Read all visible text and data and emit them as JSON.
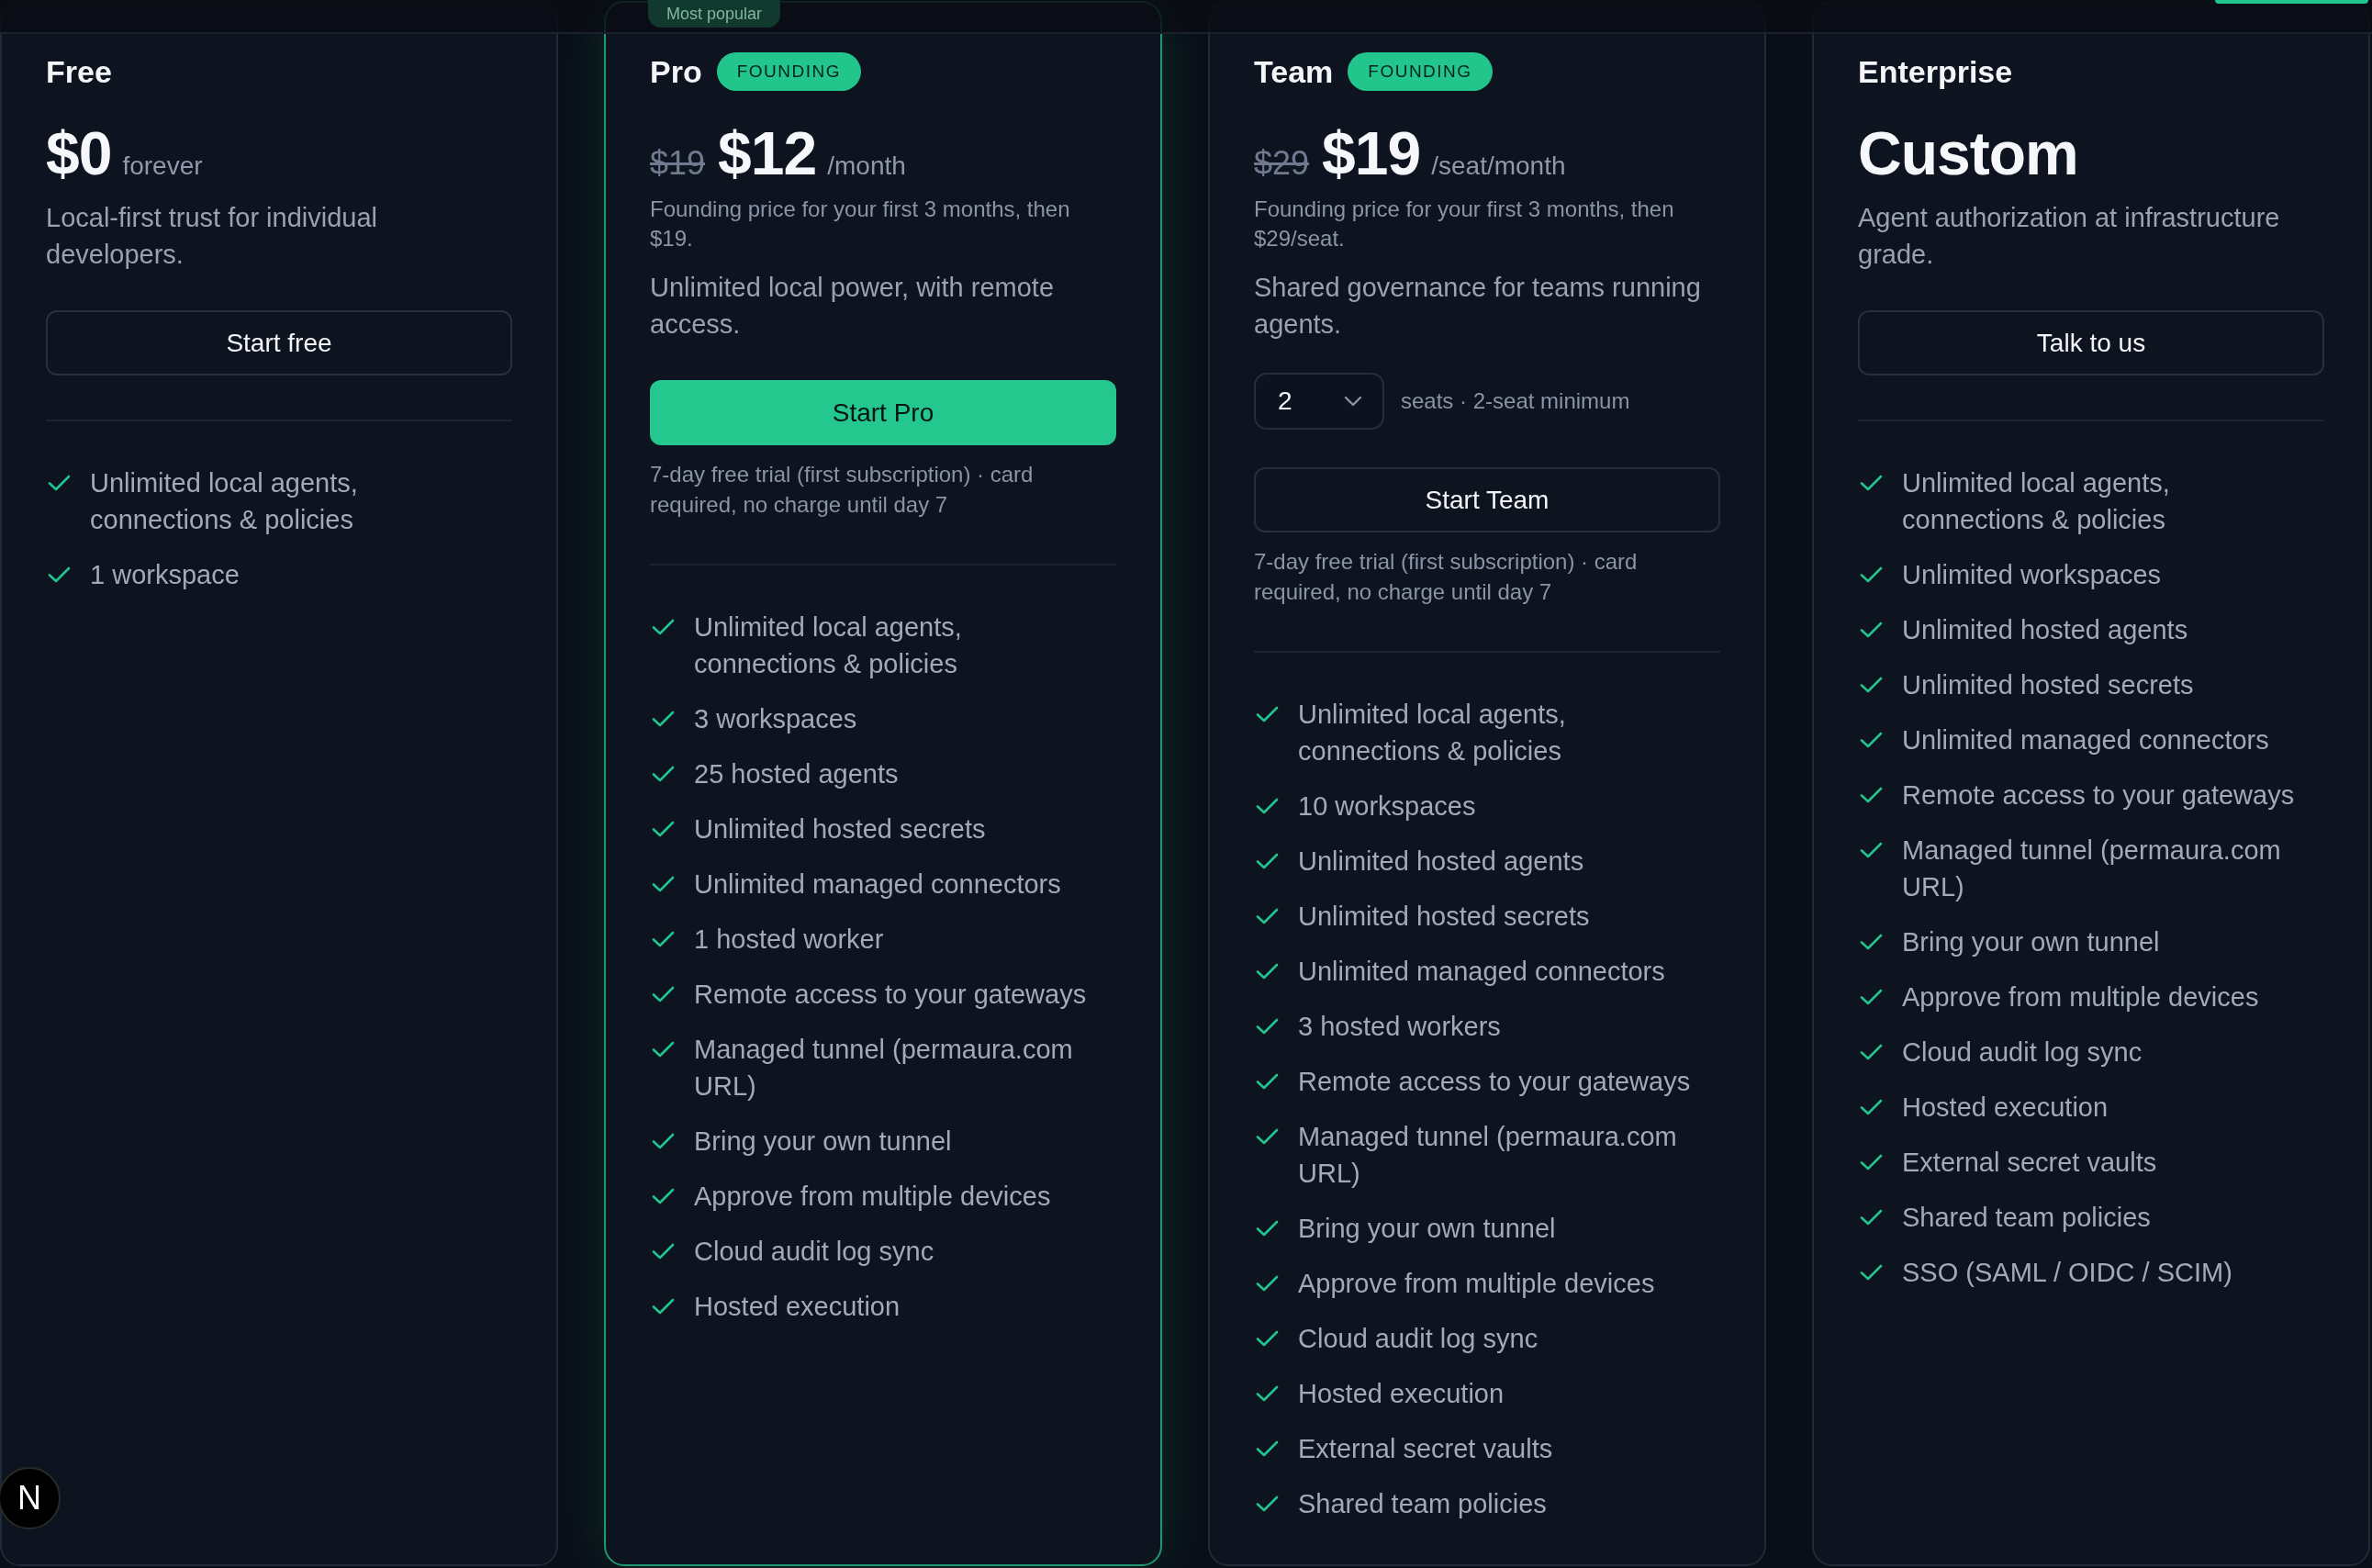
{
  "plans": [
    {
      "name": "Free",
      "featured": false,
      "price": "$0",
      "period": "forever",
      "description": "Local-first trust for individual developers.",
      "button": {
        "label": "Start free",
        "kind": "outline"
      },
      "features": [
        "Unlimited local agents, connections & policies",
        "1 workspace"
      ]
    },
    {
      "name": "Pro",
      "ribbon": "Most popular",
      "badge": "FOUNDING",
      "featured": true,
      "old_price": "$19",
      "price": "$12",
      "period": "/month",
      "note": "Founding price for your first 3 months, then $19.",
      "description": "Unlimited local power, with remote access.",
      "button": {
        "label": "Start Pro",
        "kind": "primary"
      },
      "trial_note": "7-day free trial (first subscription) · card required, no charge until day 7",
      "features": [
        "Unlimited local agents, connections & policies",
        "3 workspaces",
        "25 hosted agents",
        "Unlimited hosted secrets",
        "Unlimited managed connectors",
        "1 hosted worker",
        "Remote access to your gateways",
        "Managed tunnel (permaura.com URL)",
        "Bring your own tunnel",
        "Approve from multiple devices",
        "Cloud audit log sync",
        "Hosted execution"
      ]
    },
    {
      "name": "Team",
      "badge": "FOUNDING",
      "featured": false,
      "old_price": "$29",
      "price": "$19",
      "period": "/seat/month",
      "note": "Founding price for your first 3 months, then $29/seat.",
      "description": "Shared governance for teams running agents.",
      "seats": {
        "value": "2",
        "hint": "seats · 2-seat minimum"
      },
      "button": {
        "label": "Start Team",
        "kind": "outline"
      },
      "trial_note": "7-day free trial (first subscription) · card required, no charge until day 7",
      "features": [
        "Unlimited local agents, connections & policies",
        "10 workspaces",
        "Unlimited hosted agents",
        "Unlimited hosted secrets",
        "Unlimited managed connectors",
        "3 hosted workers",
        "Remote access to your gateways",
        "Managed tunnel (permaura.com URL)",
        "Bring your own tunnel",
        "Approve from multiple devices",
        "Cloud audit log sync",
        "Hosted execution",
        "External secret vaults",
        "Shared team policies"
      ]
    },
    {
      "name": "Enterprise",
      "featured": false,
      "price": "Custom",
      "description": "Agent authorization at infrastructure grade.",
      "button": {
        "label": "Talk to us",
        "kind": "outline"
      },
      "features": [
        "Unlimited local agents, connections & policies",
        "Unlimited workspaces",
        "Unlimited hosted agents",
        "Unlimited hosted secrets",
        "Unlimited managed connectors",
        "Remote access to your gateways",
        "Managed tunnel (permaura.com URL)",
        "Bring your own tunnel",
        "Approve from multiple devices",
        "Cloud audit log sync",
        "Hosted execution",
        "External secret vaults",
        "Shared team policies",
        "SSO (SAML / OIDC / SCIM)"
      ]
    }
  ],
  "dev_indicator": {
    "label": "N"
  }
}
